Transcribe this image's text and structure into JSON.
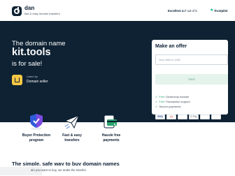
{
  "header": {
    "brand": "dan",
    "tagline": "fast & easy domain transfers",
    "rating_label": "Excellent",
    "rating_score": "4.7",
    "rating_out_of": "out of 5",
    "trustpilot_label": "Trustpilot"
  },
  "hero": {
    "line1": "The domain name",
    "domain": "kit.tools",
    "line3": "is for sale!",
    "listed_by": "Listed by",
    "seller": "Domain seller"
  },
  "offer": {
    "title": "Make an offer",
    "input_placeholder": "Your offer in USD",
    "input_value": "",
    "next_label": "Next",
    "features": [
      {
        "prefix": "",
        "highlight": "Free",
        "rest": " Ownership transfer"
      },
      {
        "prefix": "",
        "highlight": "Free",
        "rest": " Transaction support"
      },
      {
        "prefix": "Secure payments",
        "highlight": "",
        "rest": ""
      }
    ],
    "payments": [
      "VISA",
      "●●",
      "",
      "G Pay",
      "",
      "…"
    ]
  },
  "benefits": [
    {
      "label_line1": "Buyer Protection",
      "label_line2": "program",
      "icon": "shield-icon"
    },
    {
      "label_line1": "Fast & easy",
      "label_line2": "transfers",
      "icon": "paper-plane-icon"
    },
    {
      "label_line1": "Hassle free",
      "label_line2": "payments",
      "icon": "payment-card-icon"
    }
  ],
  "section": {
    "title": "The simple, safe way to buy domain names",
    "subtitle": "ain you want to buy, we make the transfer"
  },
  "colors": {
    "hero_bg": "#0e2233",
    "accent_green": "#2aa36b",
    "next_button_bg": "#e4f3ec",
    "seller_avatar": "#f7c744",
    "trustpilot_green": "#00b67a"
  }
}
